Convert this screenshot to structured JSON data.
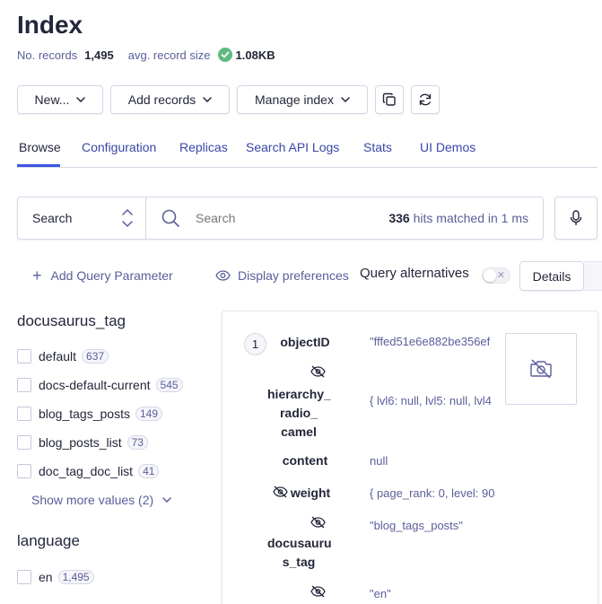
{
  "header": {
    "title": "Index",
    "records_label": "No. records",
    "records_value": "1,495",
    "avg_size_label": "avg. record size",
    "avg_size_value": "1.08KB"
  },
  "toolbar": {
    "new_label": "New...",
    "add_records_label": "Add records",
    "manage_index_label": "Manage index",
    "copy_icon": "copy-icon",
    "refresh_icon": "refresh-icon"
  },
  "tabs": [
    {
      "label": "Browse",
      "active": true
    },
    {
      "label": "Configuration"
    },
    {
      "label": "Replicas"
    },
    {
      "label": "Search API Logs"
    },
    {
      "label": "Stats"
    },
    {
      "label": "UI Demos"
    }
  ],
  "search": {
    "mode": "Search",
    "placeholder": "Search",
    "hits_count": "336",
    "hits_text": "hits matched in 1 ms"
  },
  "aux": {
    "add_query_param": "Add Query Parameter",
    "display_prefs": "Display preferences",
    "query_alternatives": "Query alternatives",
    "details": "Details"
  },
  "facets": [
    {
      "title": "docusaurus_tag",
      "items": [
        {
          "label": "default",
          "count": "637"
        },
        {
          "label": "docs-default-current",
          "count": "545"
        },
        {
          "label": "blog_tags_posts",
          "count": "149"
        },
        {
          "label": "blog_posts_list",
          "count": "73"
        },
        {
          "label": "doc_tag_doc_list",
          "count": "41"
        }
      ],
      "show_more": "Show more values (2)"
    },
    {
      "title": "language",
      "items": [
        {
          "label": "en",
          "count": "1,495"
        }
      ]
    }
  ],
  "hit": {
    "number": "1",
    "attrs": {
      "objectID": {
        "name": "objectID",
        "value": "\"fffed51e6e882be356ef"
      },
      "hierarchy": {
        "name1": "hierarchy_",
        "name2": "radio_",
        "name3": "camel",
        "value": "{ lvl6: null, lvl5: null, lvl4"
      },
      "content": {
        "name": "content",
        "value": "null"
      },
      "weight": {
        "name": "weight",
        "value": "{ page_rank: 0, level: 90"
      },
      "docusaurus_tag": {
        "name1": "docusauru",
        "name2": "s_tag",
        "value": "\"blog_tags_posts\""
      },
      "language": {
        "value": "\"en\""
      }
    }
  },
  "colors": {
    "accent": "#3a56e4",
    "text": "#23263b",
    "muted": "#5a5e9a",
    "border": "#d6d6e7",
    "success": "#5fb980"
  }
}
